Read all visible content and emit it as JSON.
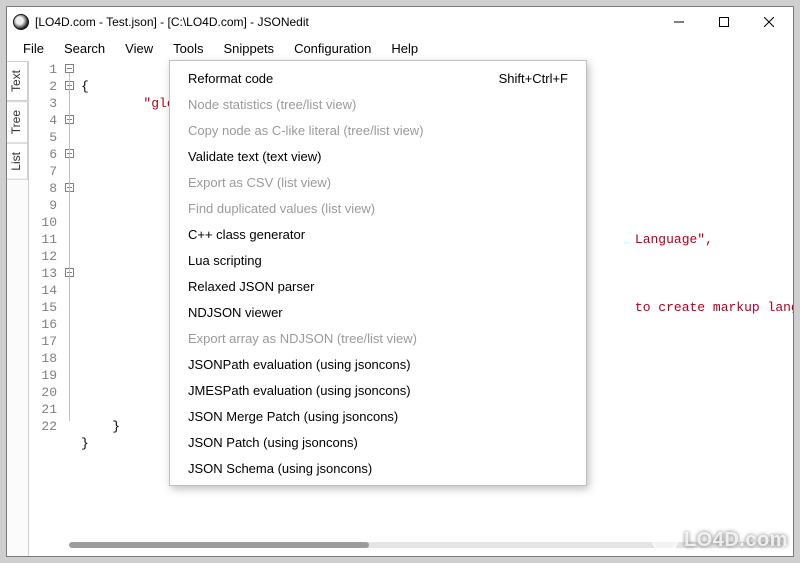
{
  "window": {
    "title": "[LO4D.com - Test.json] - [C:\\LO4D.com] - JSONedit"
  },
  "menubar": {
    "items": [
      "File",
      "Search",
      "View",
      "Tools",
      "Snippets",
      "Configuration",
      "Help"
    ],
    "open_index": 3
  },
  "sidetabs": {
    "items": [
      "Text",
      "Tree",
      "List"
    ],
    "active_index": 0
  },
  "editor": {
    "line_numbers": [
      "1",
      "2",
      "3",
      "4",
      "5",
      "6",
      "7",
      "8",
      "9",
      "10",
      "11",
      "12",
      "13",
      "14",
      "15",
      "16",
      "17",
      "18",
      "19",
      "20",
      "21",
      "22"
    ],
    "visible_code": {
      "1": "{",
      "2": "    \"glo",
      "10_tail": "Language\",",
      "14_tail": "to create markup languages s",
      "21": "    }",
      "22": "}"
    },
    "fold_markers_at_lines": [
      1,
      2,
      4,
      6,
      8,
      13
    ],
    "highlight_lines": [
      21,
      22
    ]
  },
  "tools_menu": {
    "items": [
      {
        "label": "Reformat code",
        "accel": "Shift+Ctrl+F",
        "enabled": true
      },
      {
        "label": "Node statistics (tree/list view)",
        "enabled": false
      },
      {
        "label": "Copy node as C-like literal (tree/list view)",
        "enabled": false
      },
      {
        "label": "Validate text (text view)",
        "enabled": true
      },
      {
        "label": "Export as CSV (list view)",
        "enabled": false
      },
      {
        "label": "Find duplicated values (list view)",
        "enabled": false
      },
      {
        "label": "C++ class generator",
        "enabled": true
      },
      {
        "label": "Lua scripting",
        "enabled": true
      },
      {
        "label": "Relaxed JSON parser",
        "enabled": true
      },
      {
        "label": "NDJSON viewer",
        "enabled": true
      },
      {
        "label": "Export array as NDJSON (tree/list view)",
        "enabled": false
      },
      {
        "label": "JSONPath evaluation (using jsoncons)",
        "enabled": true
      },
      {
        "label": "JMESPath evaluation (using jsoncons)",
        "enabled": true
      },
      {
        "label": "JSON Merge Patch (using jsoncons)",
        "enabled": true
      },
      {
        "label": "JSON Patch (using jsoncons)",
        "enabled": true
      },
      {
        "label": "JSON Schema (using jsoncons)",
        "enabled": true
      }
    ]
  },
  "watermark": {
    "text": "LO4D.com"
  }
}
